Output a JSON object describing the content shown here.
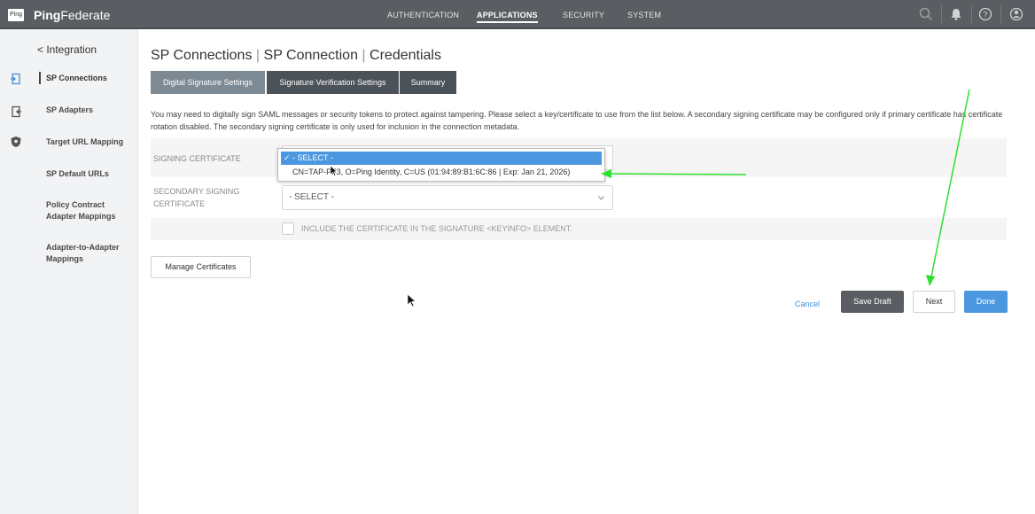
{
  "header": {
    "logo_text": "Ping",
    "brand_bold": "Ping",
    "brand_rest": "Federate",
    "nav": [
      "AUTHENTICATION",
      "APPLICATIONS",
      "SECURITY",
      "SYSTEM"
    ],
    "active_nav": "APPLICATIONS"
  },
  "sidebar": {
    "back_label": "Integration",
    "items": [
      {
        "label": "SP Connections",
        "active": true
      },
      {
        "label": "SP Adapters"
      },
      {
        "label": "Target URL Mapping"
      },
      {
        "label": "SP Default URLs"
      },
      {
        "label": "Policy Contract Adapter Mappings"
      },
      {
        "label": "Adapter-to-Adapter Mappings"
      }
    ]
  },
  "main": {
    "breadcrumb": [
      "SP Connections",
      "SP Connection",
      "Credentials"
    ],
    "tabs": [
      "Digital Signature Settings",
      "Signature Verification Settings",
      "Summary"
    ],
    "active_tab": "Digital Signature Settings",
    "description": "You may need to digitally sign SAML messages or security tokens to protect against tampering. Please select a key/certificate to use from the list below. A secondary signing certificate may be configured only if primary certificate has certificate rotation disabled. The secondary signing certificate is only used for inclusion in the connection metadata.",
    "signing_certificate": {
      "label": "SIGNING CERTIFICATE",
      "options": [
        "✓ - SELECT -",
        "CN=TAP-PF3, O=Ping Identity, C=US (01:94:89:B1:6C:86 | Exp: Jan 21, 2026)"
      ],
      "selected": "- SELECT -",
      "dropdown_open": true
    },
    "secondary_signing_certificate": {
      "label": "SECONDARY SIGNING CERTIFICATE",
      "value": "- SELECT -"
    },
    "include_certificate_label": "INCLUDE THE CERTIFICATE IN THE SIGNATURE <KEYINFO> ELEMENT.",
    "include_certificate_checked": false,
    "manage_certificates_label": "Manage Certificates",
    "actions": {
      "cancel": "Cancel",
      "save_draft": "Save Draft",
      "next": "Next",
      "done": "Done"
    }
  },
  "colors": {
    "topbar": "#5a5e62",
    "accent_blue": "#4b97e0",
    "annotation_green": "#2ee02e"
  }
}
